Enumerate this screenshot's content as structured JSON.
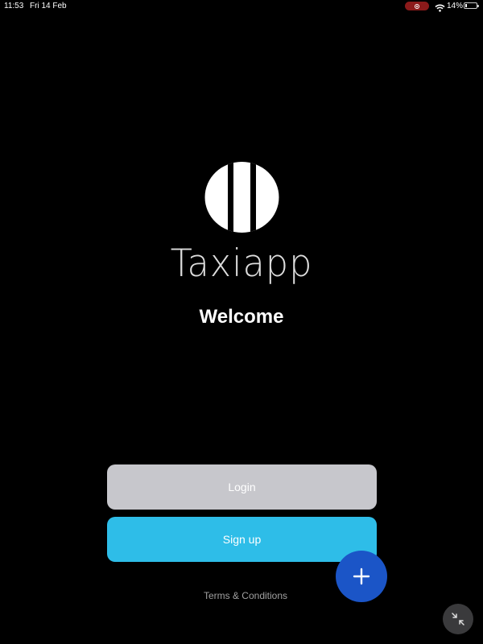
{
  "status_bar": {
    "time": "11:53",
    "date": "Fri 14 Feb",
    "battery_percent": "14%",
    "battery_level": 0.14,
    "recording_color": "#8b1a1a",
    "icons": [
      "record-icon",
      "wifi-icon",
      "battery-icon"
    ]
  },
  "brand": {
    "logo_icon": "taxiapp-logo-icon",
    "name": "Taxiapp"
  },
  "welcome": "Welcome",
  "buttons": {
    "login": "Login",
    "signup": "Sign up"
  },
  "terms_link": "Terms & Conditions",
  "fab": {
    "icon": "plus-icon",
    "color": "#1b55c7"
  },
  "collapse_button": {
    "icon": "collapse-arrows-icon"
  },
  "colors": {
    "background": "#000000",
    "login_button": "#c7c7cc",
    "signup_button": "#2ebde8"
  }
}
